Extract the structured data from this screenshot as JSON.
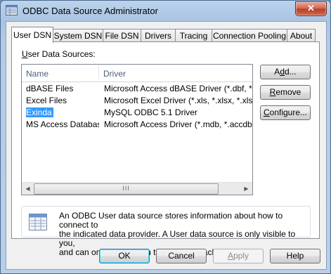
{
  "window": {
    "title": "ODBC Data Source Administrator",
    "close_label": "✕"
  },
  "tabs": [
    {
      "label": "User DSN",
      "active": true
    },
    {
      "label": "System DSN"
    },
    {
      "label": "File DSN"
    },
    {
      "label": "Drivers"
    },
    {
      "label": "Tracing"
    },
    {
      "label": "Connection Pooling"
    },
    {
      "label": "About"
    }
  ],
  "user_dsn": {
    "section_label_mnemonic": "U",
    "section_label_rest": "ser Data Sources:",
    "columns": {
      "name": "Name",
      "driver": "Driver"
    },
    "rows": [
      {
        "name": "dBASE Files",
        "driver": "Microsoft Access dBASE Driver (*.dbf, *.ndx"
      },
      {
        "name": "Excel Files",
        "driver": "Microsoft Excel Driver (*.xls, *.xlsx, *.xlsm, *.x"
      },
      {
        "name": "Exinda",
        "driver": "MySQL ODBC 5.1 Driver",
        "selected": true
      },
      {
        "name": "MS Access Database",
        "driver": "Microsoft Access Driver (*.mdb, *.accdb)"
      }
    ],
    "scroll_thumb_grip": "III",
    "buttons": {
      "add_pre": "A",
      "add_mn": "d",
      "add_post": "d...",
      "remove_mn": "R",
      "remove_post": "emove",
      "configure_pre": "",
      "configure_mn": "C",
      "configure_post": "onfigure..."
    },
    "info_lines": [
      "An ODBC User data source stores information about how to connect to",
      "the indicated data provider.   A User data source is only visible to you,",
      "and can only be used on the current machine."
    ]
  },
  "footer": {
    "ok": "OK",
    "cancel": "Cancel",
    "apply_mn": "A",
    "apply_post": "pply",
    "help": "Help"
  },
  "icons": {
    "app": "odbc-app-icon",
    "info": "database-table-icon",
    "scroll_left": "arrow-left-icon",
    "scroll_right": "arrow-right-icon"
  },
  "colors": {
    "selection": "#3399ff",
    "close_button": "#c7432a",
    "title_bar": "#b4cbe6"
  }
}
